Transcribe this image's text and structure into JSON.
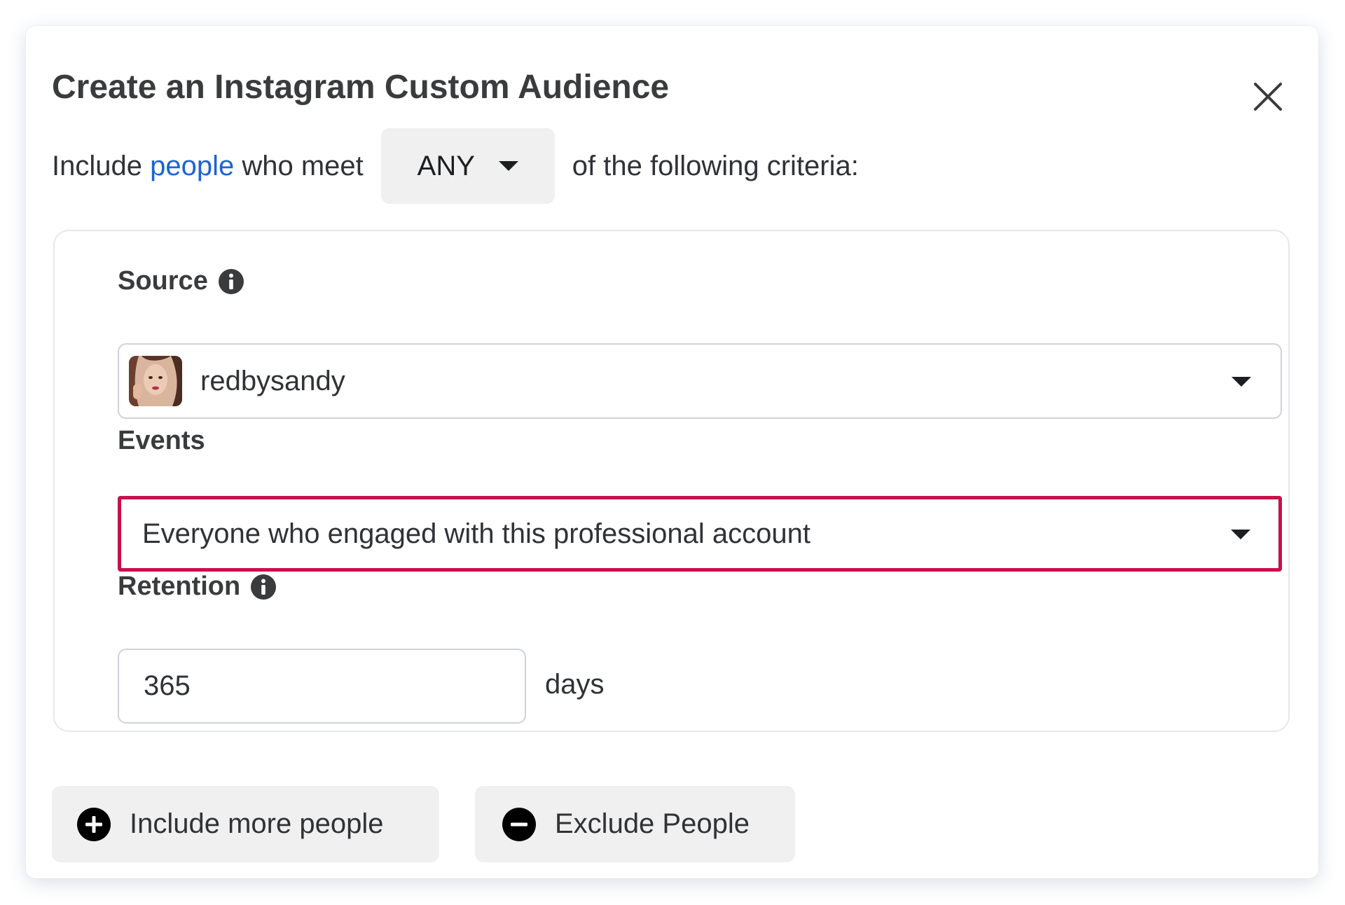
{
  "dialog": {
    "title": "Create an Instagram Custom Audience",
    "close_icon": "close-icon"
  },
  "criteria": {
    "prefix": "Include",
    "link": "people",
    "middle": "who meet",
    "match_value": "ANY",
    "suffix": "of the following criteria:"
  },
  "source": {
    "label": "Source",
    "value": "redbysandy",
    "avatar_icon": "profile-photo"
  },
  "events": {
    "label": "Events",
    "value": "Everyone who engaged with this professional account",
    "highlight_color": "#c8104c"
  },
  "retention": {
    "label": "Retention",
    "value": "365",
    "unit": "days"
  },
  "actions": {
    "include_label": "Include more people",
    "exclude_label": "Exclude People"
  },
  "colors": {
    "link": "#1d63d3",
    "button_bg": "#f0f0f0",
    "text": "#303236"
  }
}
